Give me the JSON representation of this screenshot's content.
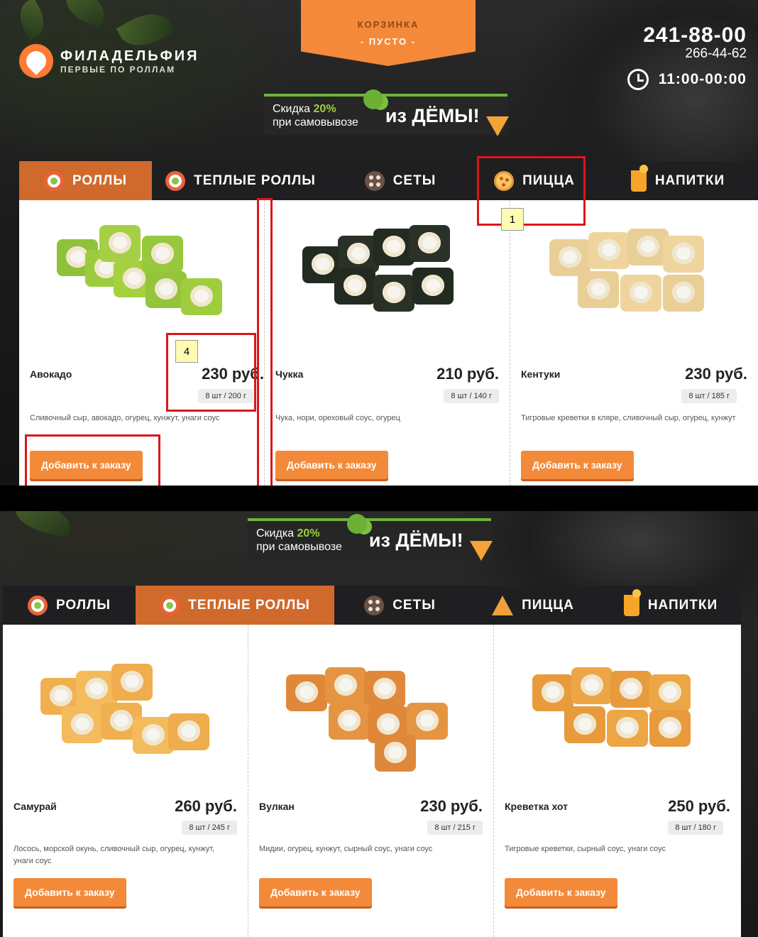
{
  "brand": {
    "name": "ФИЛАДЕЛЬФИЯ",
    "tagline": "ПЕРВЫЕ ПО РОЛЛАМ"
  },
  "cart": {
    "title": "КОРЗИНКА",
    "status": "- ПУСТО -"
  },
  "contacts": {
    "phone_main": "241-88-00",
    "phone_alt": "266-44-62",
    "hours": "11:00-00:00"
  },
  "promo": {
    "line1_prefix": "Скидка ",
    "line1_pct": "20%",
    "line2": "при самовывозе",
    "right": "из ДЁМЫ!"
  },
  "tabs": [
    {
      "label": "РОЛЛЫ",
      "icon": "roll-icon"
    },
    {
      "label": "ТЕПЛЫЕ РОЛЛЫ",
      "icon": "roll-icon"
    },
    {
      "label": "СЕТЫ",
      "icon": "set-icon"
    },
    {
      "label": "ПИЦЦА",
      "icon": "pizza-icon"
    },
    {
      "label": "НАПИТКИ",
      "icon": "drink-icon"
    }
  ],
  "screen1": {
    "active_tab": "РОЛЛЫ",
    "products": [
      {
        "name": "Авокадо",
        "price": "230 руб.",
        "weight": "8 шт / 200 г",
        "desc": "Сливочный сыр, авокадо, огурец, кунжут, унаги соус",
        "button": "Добавить к заказу"
      },
      {
        "name": "Чукка",
        "price": "210 руб.",
        "weight": "8 шт / 140 г",
        "desc": "Чука, нори, ореховый соус, огурец",
        "button": "Добавить к заказу"
      },
      {
        "name": "Кентуки",
        "price": "230 руб.",
        "weight": "8 шт / 185 г",
        "desc": "Тигровые креветки в кляре, сливочный сыр, огурец, кунжут",
        "button": "Добавить к заказу"
      }
    ]
  },
  "screen2": {
    "active_tab": "ТЕПЛЫЕ РОЛЛЫ",
    "products": [
      {
        "name": "Самурай",
        "price": "260 руб.",
        "weight": "8 шт / 245 г",
        "desc": "Лосось, морской окунь, сливочный сыр, огурец, кунжут, унаги соус",
        "button": "Добавить к заказу"
      },
      {
        "name": "Вулкан",
        "price": "230 руб.",
        "weight": "8 шт / 215 г",
        "desc": "Мидии, огурец, кунжут, сырный соус, унаги соус",
        "button": "Добавить к заказу"
      },
      {
        "name": "Креветка хот",
        "price": "250 руб.",
        "weight": "8 шт / 180 г",
        "desc": "Тигровые креветки, сырный соус, унаги соус",
        "button": "Добавить к заказу"
      }
    ]
  },
  "annotations": [
    "1",
    "4"
  ],
  "colors": {
    "accent": "#f38a3a",
    "active_tab": "#d0692c",
    "tab_bar": "#1f1f21",
    "annotation": "#d9161c"
  }
}
